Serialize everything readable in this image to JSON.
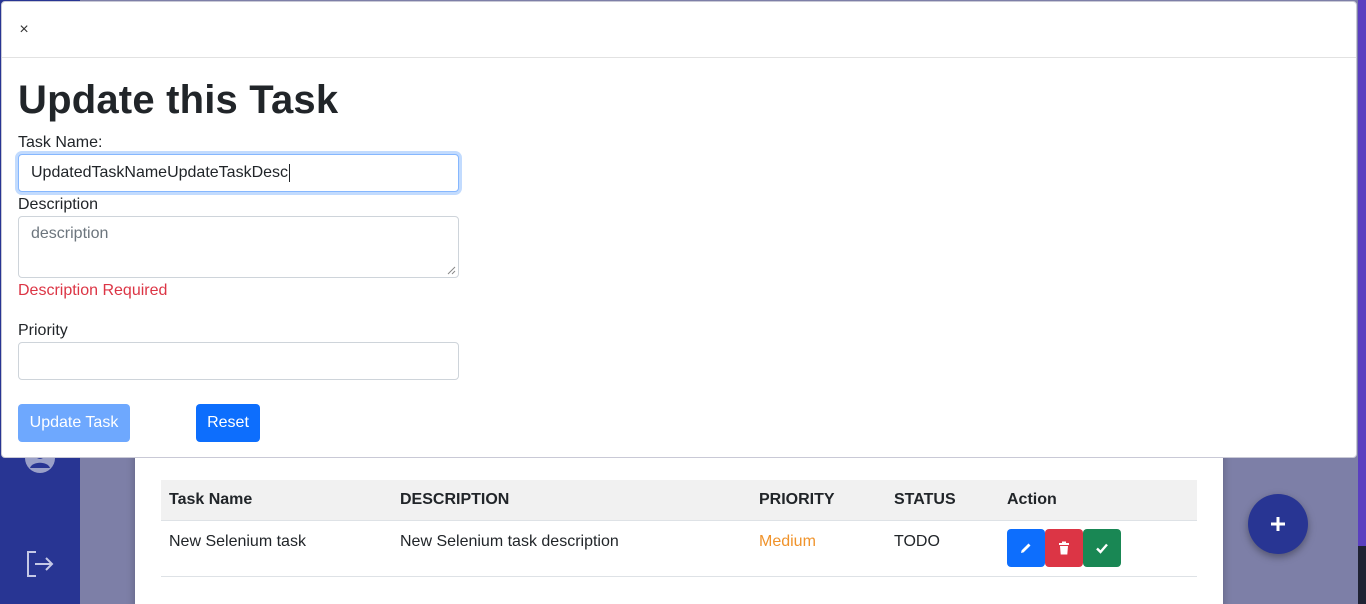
{
  "modal": {
    "close_label": "×",
    "title": "Update this Task",
    "task_name_label": "Task Name:",
    "task_name_value": "UpdatedTaskNameUpdateTaskDesc",
    "description_label": "Description",
    "description_placeholder": "description",
    "description_value": "",
    "description_error": "Description Required",
    "priority_label": "Priority",
    "priority_value": "",
    "update_button": "Update Task",
    "reset_button": "Reset"
  },
  "table": {
    "headers": [
      "Task Name",
      "DESCRIPTION",
      "PRIORITY",
      "STATUS",
      "Action"
    ],
    "rows": [
      {
        "task_name": "New Selenium task",
        "description": "New Selenium task description",
        "priority": "Medium",
        "status": "TODO"
      }
    ]
  },
  "fab_label": "+",
  "colors": {
    "sidebar": "#283593",
    "primary": "#0d6efd",
    "primary_disabled": "#6ea8fe",
    "danger": "#dc3545",
    "success": "#198754",
    "priority_medium": "#f0932b",
    "error": "#dc3545"
  },
  "icons": {
    "sidebar": [
      "profile-icon",
      "logout-icon"
    ],
    "actions": [
      "pencil-icon",
      "trash-icon",
      "check-icon"
    ],
    "fab": "plus-icon"
  }
}
